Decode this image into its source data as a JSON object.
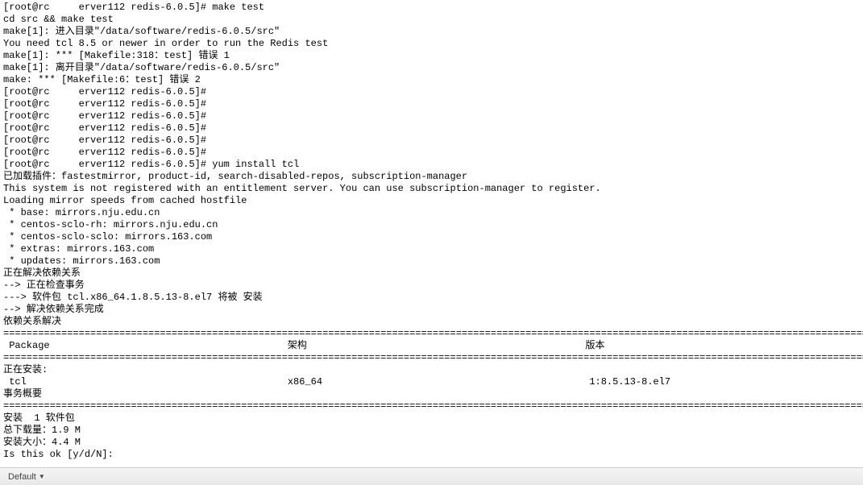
{
  "terminal": {
    "hostRedacted": "     ",
    "lines": [
      "[root@rc{BLUR}erver112 redis-6.0.5]# make test",
      "cd src && make test",
      "make[1]: 进入目录\"/data/software/redis-6.0.5/src\"",
      "You need tcl 8.5 or newer in order to run the Redis test",
      "make[1]: *** [Makefile:318：test] 错误 1",
      "make[1]: 离开目录\"/data/software/redis-6.0.5/src\"",
      "make: *** [Makefile:6：test] 错误 2",
      "[root@rc{BLUR}erver112 redis-6.0.5]#",
      "[root@rc{BLUR}erver112 redis-6.0.5]#",
      "[root@rc{BLUR}erver112 redis-6.0.5]#",
      "[root@rc{BLUR}erver112 redis-6.0.5]#",
      "[root@rc{BLUR}erver112 redis-6.0.5]#",
      "[root@rc{BLUR}erver112 redis-6.0.5]#",
      "[root@rc{BLUR}erver112 redis-6.0.5]# yum install tcl",
      "已加载插件：fastestmirror, product-id, search-disabled-repos, subscription-manager",
      "",
      "This system is not registered with an entitlement server. You can use subscription-manager to register.",
      "",
      "Loading mirror speeds from cached hostfile",
      " * base: mirrors.nju.edu.cn",
      " * centos-sclo-rh: mirrors.nju.edu.cn",
      " * centos-sclo-sclo: mirrors.163.com",
      " * extras: mirrors.163.com",
      " * updates: mirrors.163.com",
      "正在解决依赖关系",
      "--> 正在检查事务",
      "---> 软件包 tcl.x86_64.1.8.5.13-8.el7 将被 安装",
      "--> 解决依赖关系完成",
      "",
      "依赖关系解决",
      "",
      "=========================================================================================================================================================",
      " Package                                         架构                                                版本",
      "=========================================================================================================================================================",
      "正在安装:",
      " tcl                                             x86_64                                              1:8.5.13-8.el7",
      "",
      "事务概要",
      "=========================================================================================================================================================",
      "安装  1 软件包",
      "",
      "总下载量：1.9 M",
      "安装大小：4.4 M",
      "Is this ok [y/d/N]: "
    ]
  },
  "statusBar": {
    "label": "Default"
  }
}
